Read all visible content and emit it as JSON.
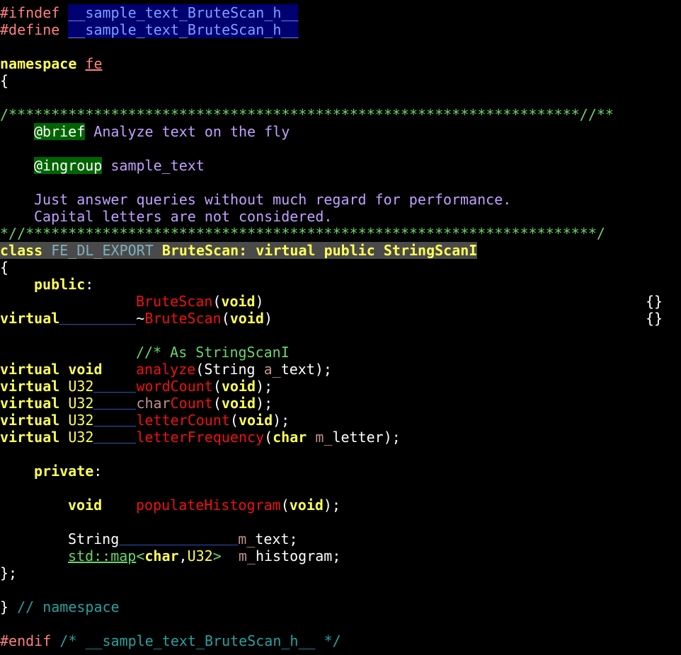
{
  "window": {
    "background": "#000000",
    "font": "monospace"
  },
  "colors": {
    "keyword": "#ffff55",
    "function": "#ee1111",
    "preprocessor": "#ff8080",
    "macro_fg": "#7f9fff",
    "macro_bg": "#000070",
    "doc_comment": "#c0a0ff",
    "comment_stars": "#6ad56a",
    "doc_tag_bg": "#006400",
    "class_line_bg": "#4a4a4a",
    "line_comment": "#28a0a0"
  },
  "code": {
    "l1": {
      "directive": "#ifndef",
      "macro": "__sample_text_BruteScan_h__"
    },
    "l2": {
      "directive": "#define",
      "macro": "__sample_text_BruteScan_h__"
    },
    "l4": {
      "keyword": "namespace",
      "name": "fe"
    },
    "l5": {
      "brace": "{"
    },
    "l7": {
      "stars": "/*******************************************************************//**"
    },
    "l8": {
      "tag": "@brief",
      "text": " Analyze text on the fly"
    },
    "l10": {
      "tag": "@ingroup",
      "text": " sample_text"
    },
    "l12": {
      "text": "Just answer queries without much regard for performance."
    },
    "l13": {
      "text": "Capital letters are not considered."
    },
    "l14": {
      "stars": "*//*******************************************************************/"
    },
    "l15": {
      "keyword": "class",
      "export": "FE_DL_EXPORT",
      "rest": "BruteScan: virtual public StringScanI"
    },
    "l16": {
      "brace": "{"
    },
    "l17": {
      "access": "public",
      "colon": ":"
    },
    "l18": {
      "name": "BruteScan",
      "open": "(",
      "arg": "void",
      "close": ")",
      "body": "{}"
    },
    "l19": {
      "keyword": "virtual",
      "tilde": "~",
      "name": "BruteScan",
      "open": "(",
      "arg": "void",
      "close": ")",
      "body": "{}"
    },
    "l21": {
      "comment": "//* As StringScanI"
    },
    "l22": {
      "keyword": "virtual",
      "type": "void",
      "name": "analyze",
      "args": "(String ",
      "param_prefix": "a_",
      "param": "text",
      "tail": ");"
    },
    "l23": {
      "keyword": "virtual",
      "type": "U32",
      "name": "wordCount",
      "open": "(",
      "arg": "void",
      "close": ");"
    },
    "l24": {
      "keyword": "virtual",
      "type": "U32",
      "name_prefix": "char",
      "name": "Count",
      "open": "(",
      "arg": "void",
      "close": ");"
    },
    "l25": {
      "keyword": "virtual",
      "type": "U32",
      "name": "letterCount",
      "open": "(",
      "arg": "void",
      "close": ");"
    },
    "l26": {
      "keyword": "virtual",
      "type": "U32",
      "name": "letterFrequency",
      "open": "(",
      "arg_type": "char",
      "param_prefix": "m_",
      "param": "letter",
      "tail": ");"
    },
    "l28": {
      "access": "private",
      "colon": ":"
    },
    "l30": {
      "type": "void",
      "name": "populateHistogram",
      "open": "(",
      "arg": "void",
      "close": ");"
    },
    "l32": {
      "type": "String",
      "member_prefix": "m_",
      "member": "text",
      "semi": ";"
    },
    "l33": {
      "std": "std::map",
      "lt": "<",
      "arg1": "char",
      "comma": ",",
      "arg2": "U32",
      "gt": ">",
      "member_prefix": "m_",
      "member": "histogram",
      "semi": ";"
    },
    "l34": {
      "end": "};"
    },
    "l36": {
      "brace": "}",
      "comment": " // namespace"
    },
    "l38": {
      "directive": "#endif",
      "comment": " /* __sample_text_BruteScan_h__ */"
    }
  }
}
